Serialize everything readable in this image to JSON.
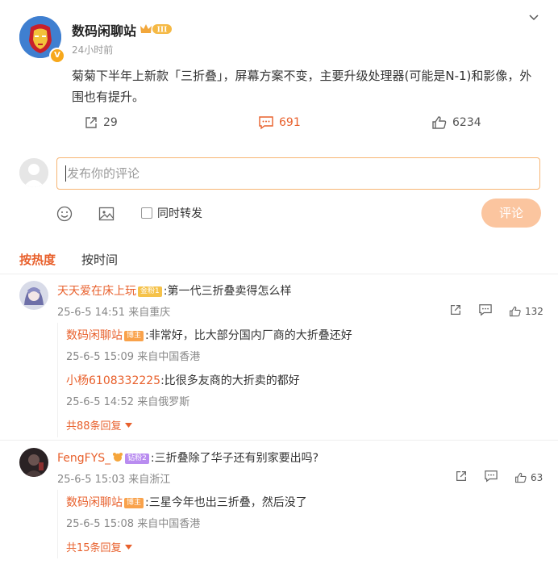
{
  "post": {
    "author": "数码闲聊站",
    "level_badge": "III",
    "verified_badge": "V",
    "time_ago": "24小时前",
    "text": "菊菊下半年上新款「三折叠」，屏幕方案不变，主要升级处理器(可能是N-1)和影像，外围也有提升。",
    "reposts": "29",
    "comments": "691",
    "likes": "6234"
  },
  "composer": {
    "placeholder": "发布你的评论",
    "repost_label": "同时转发",
    "submit_label": "评论"
  },
  "sort": {
    "hot": "按热度",
    "time": "按时间"
  },
  "comments": [
    {
      "user": "天天爱在床上玩",
      "badge": "金粉1",
      "text": ":第一代三折叠卖得怎么样",
      "meta": "25-6-5 14:51 来自重庆",
      "likes": "132",
      "replies": [
        {
          "user": "数码闲聊站",
          "badge": "博主",
          "text": ":非常好，比大部分国内厂商的大折叠还好",
          "meta": "25-6-5 15:09 来自中国香港"
        },
        {
          "user": "小杨6108332225",
          "badge": "",
          "text": ":比很多友商的大折卖的都好",
          "meta": "25-6-5 14:52 来自俄罗斯"
        }
      ],
      "more": "共88条回复"
    },
    {
      "user": "FengFYS_",
      "badge": "钻粉2",
      "text": ":三折叠除了华子还有别家要出吗?",
      "meta": "25-6-5 15:03 来自浙江",
      "likes": "63",
      "replies": [
        {
          "user": "数码闲聊站",
          "badge": "博主",
          "text": ":三星今年也出三折叠，然后没了",
          "meta": "25-6-5 15:08 来自中国香港"
        }
      ],
      "more": "共15条回复"
    }
  ],
  "colors": {
    "accent": "#e8602c",
    "submit_disabled": "#fbc59f",
    "input_border": "#f7b574"
  }
}
